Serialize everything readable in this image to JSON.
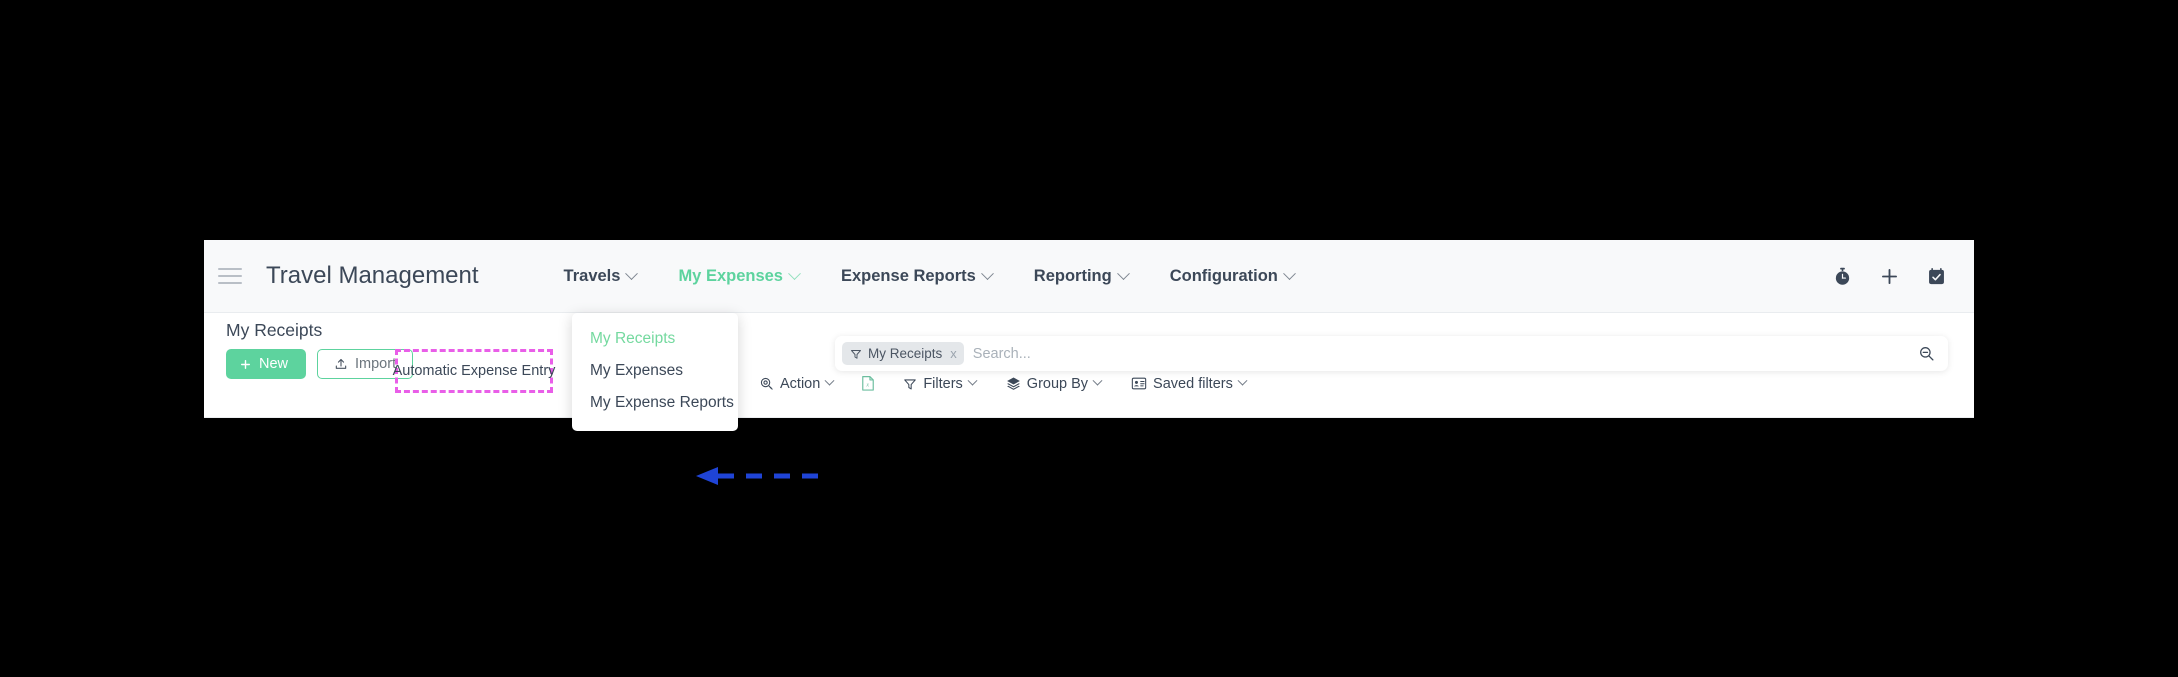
{
  "app": {
    "brand": "Travel Management",
    "menu_icon": "hamburger-icon"
  },
  "navbar": {
    "items": [
      {
        "label": "Travels",
        "active": false,
        "has_caret": true
      },
      {
        "label": "My Expenses",
        "active": true,
        "has_caret": true
      },
      {
        "label": "Expense Reports",
        "active": false,
        "has_caret": true
      },
      {
        "label": "Reporting",
        "active": false,
        "has_caret": true
      },
      {
        "label": "Configuration",
        "active": false,
        "has_caret": true
      }
    ],
    "right_icons": [
      {
        "name": "stopwatch-icon"
      },
      {
        "name": "plus-icon"
      },
      {
        "name": "calendar-check-icon"
      }
    ]
  },
  "dropdown": {
    "open_for": "My Expenses",
    "items": [
      {
        "label": "My Receipts",
        "highlighted": true
      },
      {
        "label": "My Expenses",
        "highlighted": false
      },
      {
        "label": "My Expense Reports",
        "highlighted": false
      }
    ]
  },
  "control_panel": {
    "breadcrumb": "My Receipts",
    "new_button": "New",
    "import_button": "Import",
    "toolbar": [
      {
        "label": "Action",
        "icon": "action-gear-icon",
        "caret": true
      },
      {
        "label": "",
        "icon": "export-excel-icon",
        "caret": false
      },
      {
        "label": "Filters",
        "icon": "filter-funnel-icon",
        "caret": true
      },
      {
        "label": "Group By",
        "icon": "layers-icon",
        "caret": true
      },
      {
        "label": "Saved filters",
        "icon": "saved-filters-icon",
        "caret": true
      }
    ]
  },
  "search": {
    "facet_label": "My Receipts",
    "facet_icon": "filter-funnel-icon",
    "facet_remove": "x",
    "placeholder": "Search...",
    "value": "",
    "magnifier_icon": "search-minus-icon"
  },
  "annotations": {
    "highlight_box_label": "Automatic Expense Entry",
    "highlight_box_color": "#e95ee8",
    "arrow_color": "#1f44d6",
    "arrow_points_to": "My Receipts"
  },
  "colors": {
    "accent_green": "#5dd39e",
    "nav_text": "#3c4858",
    "navbar_bg": "#f8f9fa",
    "page_bg": "#000000"
  }
}
